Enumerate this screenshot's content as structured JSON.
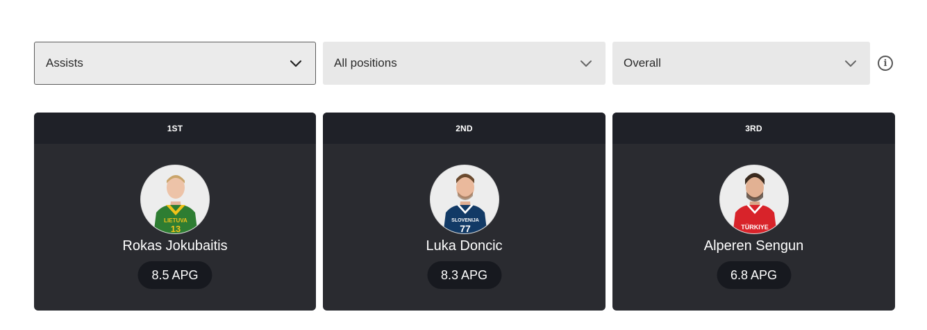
{
  "filters": {
    "stat": {
      "value": "Assists"
    },
    "position": {
      "value": "All positions"
    },
    "scope": {
      "value": "Overall"
    },
    "info_icon": "info-icon"
  },
  "leaders": [
    {
      "rank": "1ST",
      "name": "Rokas Jokubaitis",
      "stat": "8.5 APG",
      "jersey_text": "LIETUVA",
      "jersey_number": "13",
      "jersey_color": "#2e7d32",
      "trim_color": "#f2c21a"
    },
    {
      "rank": "2ND",
      "name": "Luka Doncic",
      "stat": "8.3 APG",
      "jersey_text": "SLOVENIJA",
      "jersey_number": "77",
      "jersey_color": "#123a66",
      "trim_color": "#ffffff"
    },
    {
      "rank": "3RD",
      "name": "Alperen Sengun",
      "stat": "6.8 APG",
      "jersey_text": "TÜRKIYE",
      "jersey_number": "",
      "jersey_color": "#d8232a",
      "trim_color": "#ffffff"
    }
  ],
  "colors": {
    "card_bg": "#2a2b30",
    "card_header_bg": "#1f2128",
    "pill_bg": "#17191f",
    "select_bg": "#e8e8e8"
  }
}
